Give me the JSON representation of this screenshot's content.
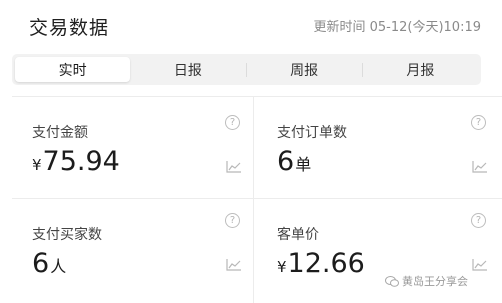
{
  "header": {
    "title": "交易数据",
    "update_time": "更新时间 05-12(今天)10:19"
  },
  "tabs": [
    {
      "label": "实时",
      "active": true
    },
    {
      "label": "日报",
      "active": false
    },
    {
      "label": "周报",
      "active": false
    },
    {
      "label": "月报",
      "active": false
    }
  ],
  "metrics": [
    {
      "label": "支付金额",
      "currency": "¥",
      "value": "75.94",
      "unit": ""
    },
    {
      "label": "支付订单数",
      "currency": "",
      "value": "6",
      "unit": "单"
    },
    {
      "label": "支付买家数",
      "currency": "",
      "value": "6",
      "unit": "人"
    },
    {
      "label": "客单价",
      "currency": "¥",
      "value": "12.66",
      "unit": ""
    }
  ],
  "icons": {
    "help": "help-circle-icon",
    "trend": "trend-chart-icon",
    "watermark": "wechat-icon"
  },
  "help_glyph": "?",
  "watermark": "黄岛王分享会",
  "colors": {
    "tab_bg": "#f2f2f2",
    "active_tab_bg": "#ffffff",
    "muted_text": "#8a8a8a",
    "divider": "#ececec"
  }
}
